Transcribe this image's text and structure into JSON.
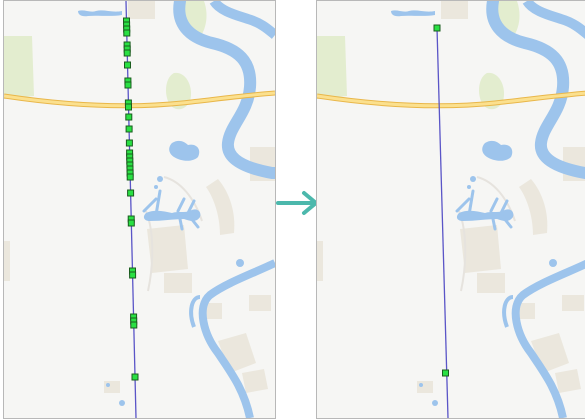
{
  "figure": {
    "panels": [
      {
        "id": "before",
        "description_state": "many-vertices"
      },
      {
        "id": "after",
        "description_state": "two-vertices"
      }
    ],
    "arrow_icon": "right-arrow-icon"
  },
  "colors": {
    "background": "#f6f6f4",
    "water": "#9dc4ec",
    "highway_fill": "#fbe08e",
    "highway_stroke": "#e9b74a",
    "park": "#e3edcf",
    "building": "#ebe7dd",
    "track_line": "#5a55c7",
    "vertex_fill": "#29e043",
    "vertex_stroke": "#1a5c1e",
    "arrow": "#4cb8ac",
    "border": "#b8b8b8"
  }
}
